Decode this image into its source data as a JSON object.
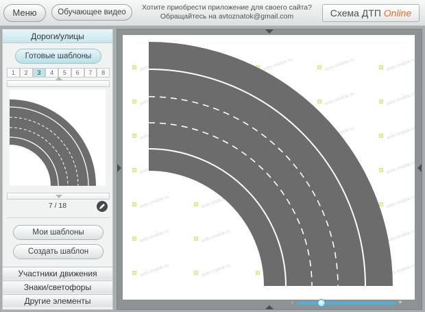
{
  "header": {
    "menu_label": "Меню",
    "video_label": "Обучающее видео",
    "ad_line1": "Хотите приобрести приложение для своего сайта?",
    "ad_line2": "Обращайтесь на avtoznatok@gmail.com",
    "brand_main": "Схема ДТП",
    "brand_online": "Online"
  },
  "sidebar": {
    "category_title": "Дороги/улицы",
    "templates_label": "Готовые шаблоны",
    "pages": [
      "1",
      "2",
      "3",
      "4",
      "5",
      "6",
      "7",
      "8"
    ],
    "active_page": "3",
    "counter": "7 / 18",
    "my_templates_label": "Мои шаблоны",
    "create_template_label": "Создать шаблон",
    "sections": [
      "Участники движения",
      "Знаки/светофоры",
      "Другие элементы"
    ]
  },
  "canvas": {
    "watermark": "avto-znatok.ru",
    "zoom_minus": "-",
    "zoom_plus": "+",
    "zoom_level": 0.25
  },
  "colors": {
    "road": "#6c6c6c",
    "accent": "#bfe3ea",
    "brand_online": "#e86b2b"
  }
}
